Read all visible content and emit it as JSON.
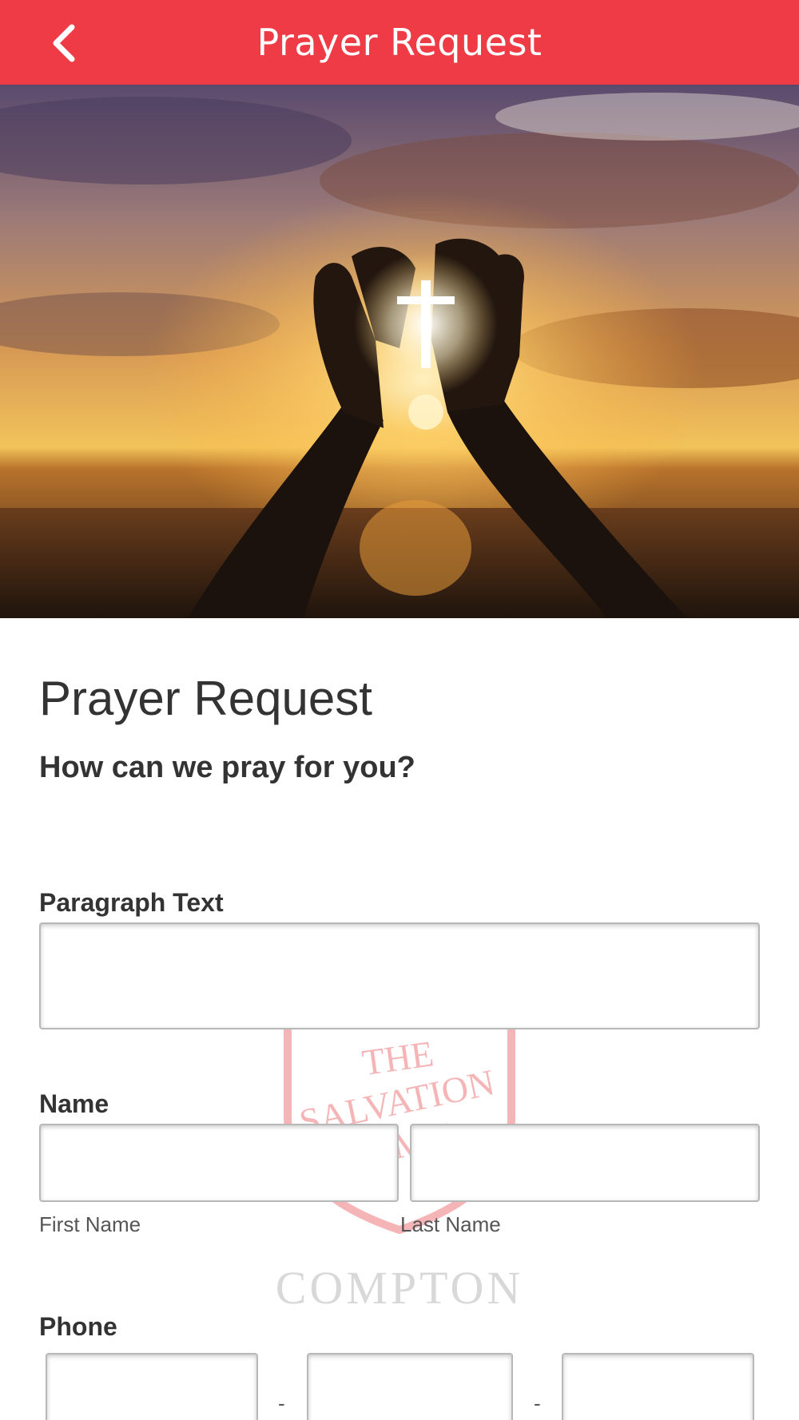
{
  "header": {
    "title": "Prayer Request",
    "background": "#ef3b45",
    "back_icon": "chevron-left-icon"
  },
  "hero": {
    "icon": "cross-icon"
  },
  "form": {
    "title": "Prayer Request",
    "subtitle": "How can we pray for you?",
    "paragraph": {
      "label": "Paragraph Text",
      "value": ""
    },
    "name": {
      "label": "Name",
      "first_label": "First Name",
      "last_label": "Last Name",
      "first_value": "",
      "last_value": ""
    },
    "phone": {
      "label": "Phone",
      "separator": "-"
    }
  },
  "watermark": {
    "shield_text_line1": "THE",
    "shield_text_line2": "SALVATION",
    "shield_text_line3": "ARMY",
    "location": "COMPTON",
    "color": "#e31b23"
  }
}
